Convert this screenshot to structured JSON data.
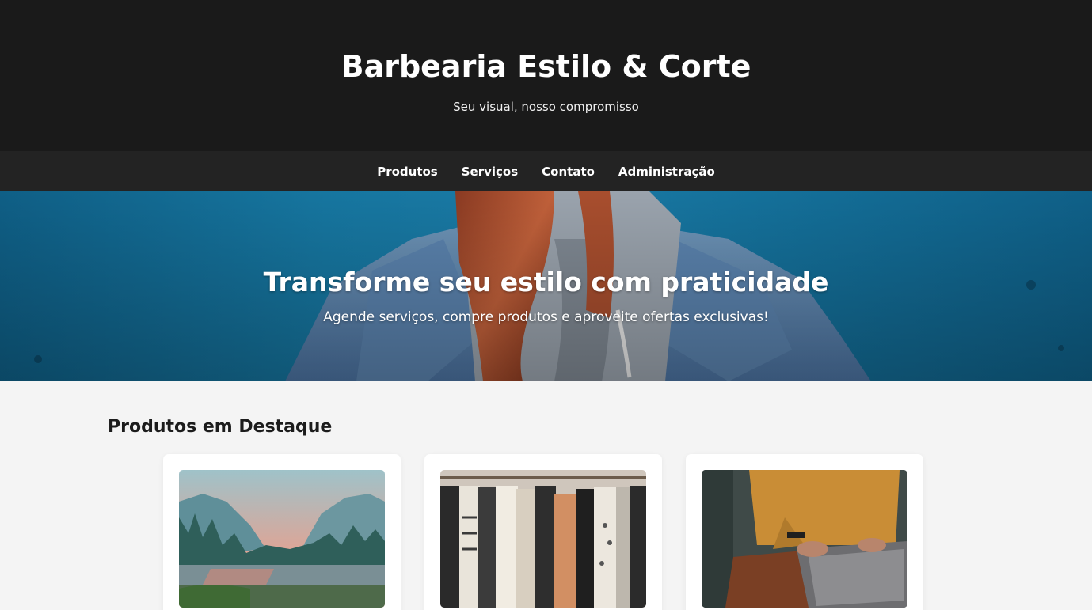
{
  "header": {
    "title": "Barbearia Estilo & Corte",
    "tagline": "Seu visual, nosso compromisso"
  },
  "nav": {
    "items": [
      {
        "label": "Produtos"
      },
      {
        "label": "Serviços"
      },
      {
        "label": "Contato"
      },
      {
        "label": "Administração"
      }
    ]
  },
  "hero": {
    "title": "Transforme seu estilo com praticidade",
    "subtitle": "Agende serviços, compre produtos e aproveite ofertas exclusivas!"
  },
  "products": {
    "section_title": "Produtos em Destaque",
    "items": [
      {
        "image": "mountain-lake-photo"
      },
      {
        "image": "clothing-rack-photo"
      },
      {
        "image": "laptop-sweater-photo"
      }
    ]
  },
  "colors": {
    "header_bg": "#1a1a1a",
    "nav_bg": "#232323",
    "page_bg": "#f4f4f4",
    "hero_blue": "#1676a0"
  }
}
